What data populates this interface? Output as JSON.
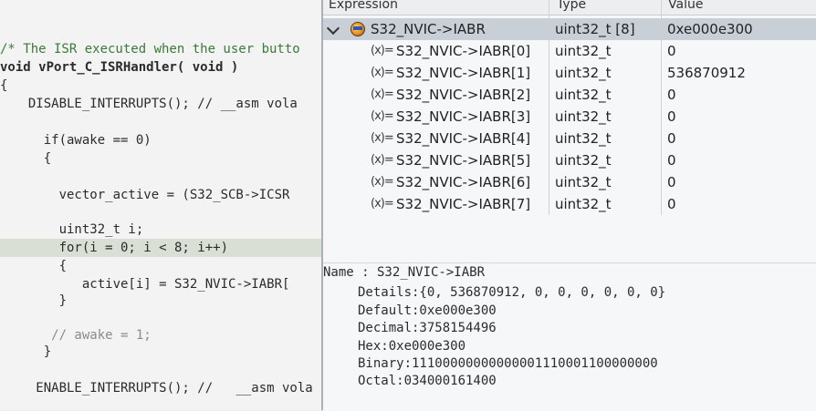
{
  "editor": {
    "lines": [
      "/* The ISR executed when the user butto",
      "void vPort_C_ISRHandler( void )",
      "{",
      "  DISABLE_INTERRUPTS(); // __asm vola",
      "",
      "    if(awake == 0)",
      "    {",
      "",
      "      vector_active = (S32_SCB->ICSR",
      "",
      "      uint32_t i;",
      "      for(i = 0; i < 8; i++)",
      "      {",
      "         active[i] = S32_NVIC->IABR[",
      "      }",
      "",
      "     // awake = 1;",
      "    }",
      "",
      "   ENABLE_INTERRUPTS(); //   __asm vola"
    ]
  },
  "expressions": {
    "headers": {
      "expression": "Expression",
      "type": "Type",
      "value": "Value"
    },
    "parent": {
      "expression": "S32_NVIC->IABR",
      "type": "uint32_t [8]",
      "value": "0xe000e300"
    },
    "children": [
      {
        "icon": "(x)=",
        "expression": "S32_NVIC->IABR[0]",
        "type": "uint32_t",
        "value": "0"
      },
      {
        "icon": "(x)=",
        "expression": "S32_NVIC->IABR[1]",
        "type": "uint32_t",
        "value": "536870912"
      },
      {
        "icon": "(x)=",
        "expression": "S32_NVIC->IABR[2]",
        "type": "uint32_t",
        "value": "0"
      },
      {
        "icon": "(x)=",
        "expression": "S32_NVIC->IABR[3]",
        "type": "uint32_t",
        "value": "0"
      },
      {
        "icon": "(x)=",
        "expression": "S32_NVIC->IABR[4]",
        "type": "uint32_t",
        "value": "0"
      },
      {
        "icon": "(x)=",
        "expression": "S32_NVIC->IABR[5]",
        "type": "uint32_t",
        "value": "0"
      },
      {
        "icon": "(x)=",
        "expression": "S32_NVIC->IABR[6]",
        "type": "uint32_t",
        "value": "0"
      },
      {
        "icon": "(x)=",
        "expression": "S32_NVIC->IABR[7]",
        "type": "uint32_t",
        "value": "0"
      }
    ]
  },
  "details": {
    "name": "Name : S32_NVIC->IABR",
    "details": "Details:{0, 536870912, 0, 0, 0, 0, 0, 0}",
    "default": "Default:0xe000e300",
    "decimal": "Decimal:3758154496",
    "hex": "Hex:0xe000e300",
    "binary": "Binary:11100000000000001110001100000000",
    "octal": "Octal:034000161400"
  },
  "icons": {
    "expand": "chevron-down-icon",
    "struct": "struct-variable-icon",
    "variable": "variable-icon"
  }
}
